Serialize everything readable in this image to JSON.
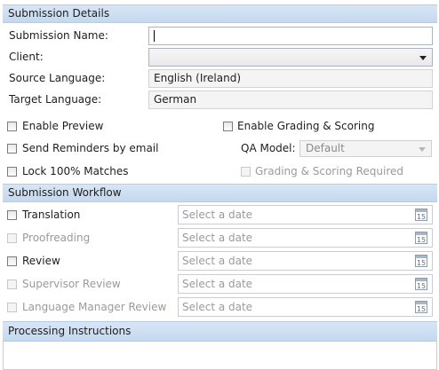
{
  "submission_details": {
    "header": "Submission Details",
    "name_label": "Submission Name:",
    "name_value": "",
    "client_label": "Client:",
    "client_value": "",
    "source_language_label": "Source Language:",
    "source_language_value": "English (Ireland)",
    "target_language_label": "Target Language:",
    "target_language_value": "German"
  },
  "options": {
    "enable_preview": "Enable Preview",
    "send_reminders": "Send Reminders by email",
    "lock_matches": "Lock 100% Matches",
    "enable_grading": "Enable Grading & Scoring",
    "qa_model_label": "QA Model:",
    "qa_model_value": "Default",
    "grading_required": "Grading & Scoring Required"
  },
  "workflow": {
    "header": "Submission Workflow",
    "date_placeholder": "Select a date",
    "calendar_day": "15",
    "steps": [
      {
        "label": "Translation",
        "enabled": true
      },
      {
        "label": "Proofreading",
        "enabled": false
      },
      {
        "label": "Review",
        "enabled": true
      },
      {
        "label": "Supervisor Review",
        "enabled": false
      },
      {
        "label": "Language Manager Review",
        "enabled": false
      }
    ]
  },
  "processing": {
    "header": "Processing Instructions",
    "value": ""
  }
}
